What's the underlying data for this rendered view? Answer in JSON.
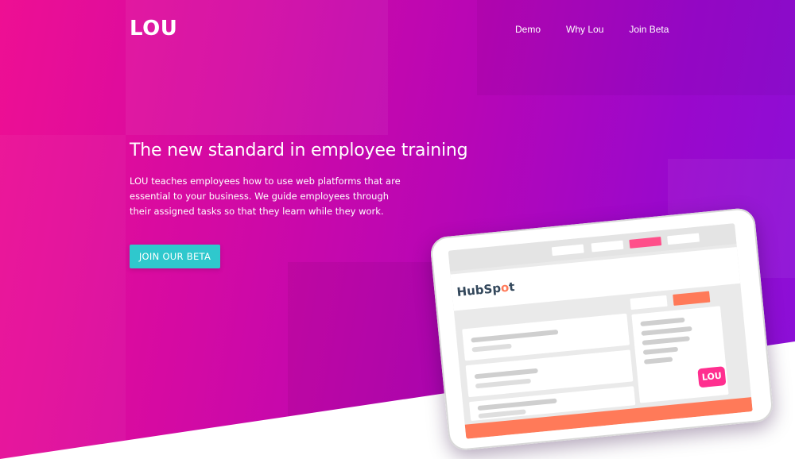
{
  "brand": {
    "logo": "LOU"
  },
  "nav": {
    "items": [
      "Demo",
      "Why Lou",
      "Join Beta"
    ]
  },
  "hero": {
    "headline": "The new standard in employee training",
    "description": "LOU teaches employees how to use web platforms that are essential to your business. We guide employees through their assigned tasks so that they learn while they work.",
    "cta_label": "JOIN OUR BETA"
  },
  "mockup": {
    "hubspot_prefix": "HubSp",
    "hubspot_o": "o",
    "hubspot_suffix": "t",
    "badge": "LOU"
  },
  "colors": {
    "gradient_start": "#ee0f93",
    "gradient_end": "#8a10d8",
    "cta": "#2fc8cd",
    "hubspot_orange": "#ff7a59",
    "badge_pink": "#ff2f8f"
  }
}
